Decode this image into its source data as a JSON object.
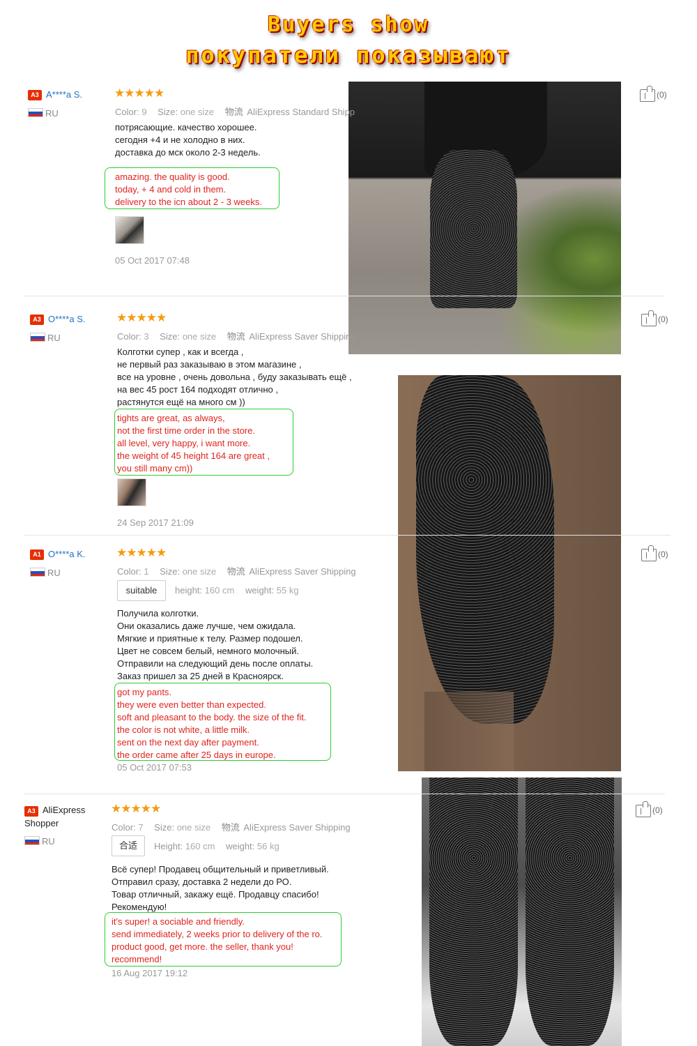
{
  "banner": {
    "title_en": "Buyers show",
    "title_ru": "покупатели показывают"
  },
  "labels": {
    "color": "Color:",
    "size": "Size:",
    "shipping_icon": "物流",
    "height": "height:",
    "weight": "weight:",
    "Height": "Height:"
  },
  "colors": {
    "accent_star": "#f39c12",
    "username": "#2270c2",
    "translation_text": "#e0241e",
    "translation_border": "#2ecc2e",
    "badge": "#e62e04"
  },
  "reviews": [
    {
      "badge": "A3",
      "user": "A****a S.",
      "country": "RU",
      "stars": "★★★★★",
      "color": "9",
      "size": "one size",
      "shipping": "AliExpress Standard Shipp",
      "body_ru": [
        "потрясающие. качество хорошее.",
        "сегодня +4 и не холодно в них.",
        "доставка до мск около 2-3 недель."
      ],
      "translation": [
        "amazing. the quality is good.",
        "today, + 4 and cold in them.",
        "delivery to the icn about 2 - 3 weeks."
      ],
      "date": "05 Oct 2017 07:48",
      "likes": "(0)"
    },
    {
      "badge": "A3",
      "user": "O****a S.",
      "country": "RU",
      "stars": "★★★★★",
      "color": "3",
      "size": "one size",
      "shipping": "AliExpress Saver Shipping",
      "body_ru": [
        "Колготки супер , как и всегда ,",
        "не первый раз заказываю в этом магазине ,",
        "все на уровне , очень довольна , буду заказывать ещё ,",
        "на вес 45 рост 164 подходят отлично ,",
        "растянутся ещё на много см ))"
      ],
      "translation": [
        "tights are great, as always,",
        "not the first time order in the store.",
        "all level, very happy, i want more.",
        "the weight of 45 height 164 are great ,",
        "you still many cm))"
      ],
      "date": "24 Sep 2017 21:09",
      "likes": "(0)"
    },
    {
      "badge": "A1",
      "user": "O****a K.",
      "country": "RU",
      "stars": "★★★★★",
      "color": "1",
      "size": "one size",
      "shipping": "AliExpress Saver Shipping",
      "fit": "suitable",
      "height": "160 cm",
      "weight": "55 kg",
      "body_ru": [
        "Получила колготки.",
        "Они оказались даже лучше, чем ожидала.",
        "Мягкие и приятные к телу. Размер подошел.",
        "Цвет не совсем белый, немного молочный.",
        "Отправили на следующий день после оплаты.",
        "Заказ пришел за 25 дней в Красноярск."
      ],
      "translation": [
        "got my pants.",
        "they were even better than expected.",
        "soft and pleasant to the body. the size of the fit.",
        "the color is not white, a little milk.",
        "sent on the next day after payment.",
        "the order came after 25 days in europe."
      ],
      "date": "05 Oct 2017 07:53",
      "likes": "(0)"
    },
    {
      "badge": "A3",
      "user": "AliExpress Shopper",
      "country": "RU",
      "stars": "★★★★★",
      "color": "7",
      "size": "one size",
      "shipping": "AliExpress Saver Shipping",
      "fit": "合适",
      "height": "160 cm",
      "weight": "56 kg",
      "body_ru": [
        "Всё супер! Продавец общительный и приветливый.",
        "Отправил сразу, доставка 2 недели до РО.",
        "Товар отличный, закажу ещё. Продавцу спасибо!",
        "Рекомендую!"
      ],
      "translation": [
        "it's super! a sociable and friendly.",
        "send immediately, 2 weeks prior to delivery of the ro.",
        "product good, get more. the seller, thank you!",
        "recommend!"
      ],
      "date": "16 Aug 2017 19:12",
      "likes": "(0)"
    }
  ]
}
